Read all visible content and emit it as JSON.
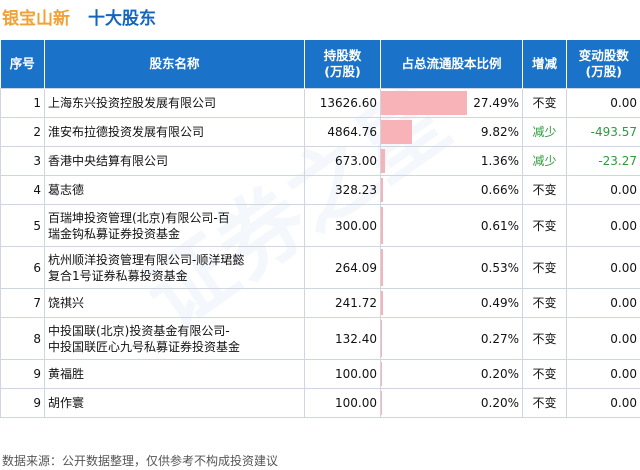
{
  "header": {
    "company": "银宝山新",
    "title": "十大股东"
  },
  "columns": {
    "rank": "序号",
    "name": "股东名称",
    "shares_line1": "持股数",
    "shares_line2": "(万股)",
    "ratio": "占总流通股本比例",
    "change": "增减",
    "delta_line1": "变动股数",
    "delta_line2": "(万股)"
  },
  "rows": [
    {
      "rank": "1",
      "name_line1": "上海东兴投资控股发展有限公司",
      "name_line2": "",
      "shares": "13626.60",
      "ratio_text": "27.49%",
      "ratio": 27.49,
      "change": "不变",
      "change_dir": "same",
      "delta": "0.00"
    },
    {
      "rank": "2",
      "name_line1": "淮安布拉德投资发展有限公司",
      "name_line2": "",
      "shares": "4864.76",
      "ratio_text": "9.82%",
      "ratio": 9.82,
      "change": "减少",
      "change_dir": "down",
      "delta": "-493.57"
    },
    {
      "rank": "3",
      "name_line1": "香港中央结算有限公司",
      "name_line2": "",
      "shares": "673.00",
      "ratio_text": "1.36%",
      "ratio": 1.36,
      "change": "减少",
      "change_dir": "down",
      "delta": "-23.27"
    },
    {
      "rank": "4",
      "name_line1": "葛志德",
      "name_line2": "",
      "shares": "328.23",
      "ratio_text": "0.66%",
      "ratio": 0.66,
      "change": "不变",
      "change_dir": "same",
      "delta": "0.00"
    },
    {
      "rank": "5",
      "name_line1": "百瑞坤投资管理(北京)有限公司-百",
      "name_line2": "瑞金钩私募证券投资基金",
      "shares": "300.00",
      "ratio_text": "0.61%",
      "ratio": 0.61,
      "change": "不变",
      "change_dir": "same",
      "delta": "0.00"
    },
    {
      "rank": "6",
      "name_line1": "杭州顺洋投资管理有限公司-顺洋珺懿",
      "name_line2": "复合1号证券私募投资基金",
      "shares": "264.09",
      "ratio_text": "0.53%",
      "ratio": 0.53,
      "change": "不变",
      "change_dir": "same",
      "delta": "0.00"
    },
    {
      "rank": "7",
      "name_line1": "饶祺兴",
      "name_line2": "",
      "shares": "241.72",
      "ratio_text": "0.49%",
      "ratio": 0.49,
      "change": "不变",
      "change_dir": "same",
      "delta": "0.00"
    },
    {
      "rank": "8",
      "name_line1": "中投国联(北京)投资基金有限公司-",
      "name_line2": "中投国联匠心九号私募证券投资基金",
      "shares": "132.40",
      "ratio_text": "0.27%",
      "ratio": 0.27,
      "change": "不变",
      "change_dir": "same",
      "delta": "0.00"
    },
    {
      "rank": "9",
      "name_line1": "黄福胜",
      "name_line2": "",
      "shares": "100.00",
      "ratio_text": "0.20%",
      "ratio": 0.2,
      "change": "不变",
      "change_dir": "same",
      "delta": "0.00"
    },
    {
      "rank": "9",
      "name_line1": "胡作寰",
      "name_line2": "",
      "shares": "100.00",
      "ratio_text": "0.20%",
      "ratio": 0.2,
      "change": "不变",
      "change_dir": "same",
      "delta": "0.00"
    }
  ],
  "bar_max_ratio": 27.49,
  "colors": {
    "header_bg": "#1a73c8",
    "company": "#f0a238",
    "title": "#1565c0",
    "bar": "#f7b3b8",
    "decrease": "#2e9a3c"
  },
  "footer": {
    "source": "数据来源：公开数据整理，仅供参考不构成投资建议"
  }
}
